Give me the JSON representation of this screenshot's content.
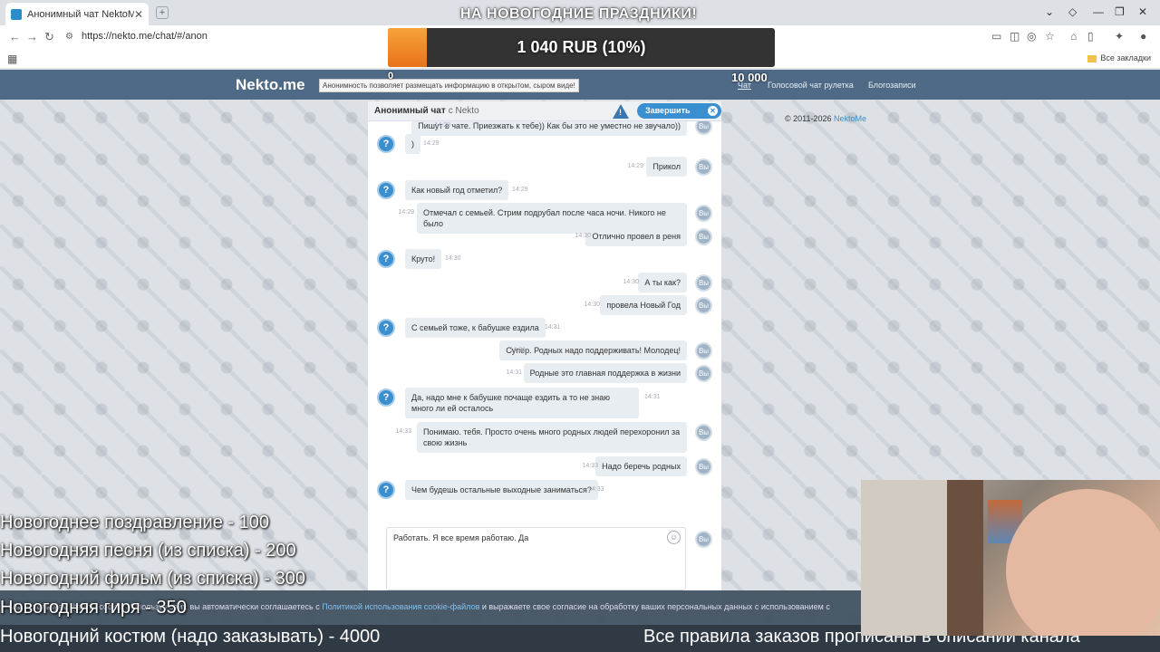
{
  "browser": {
    "tab_title": "Анонимный чат NektoMe",
    "url": "https://nekto.me/chat/#/anon",
    "bookmarks_all": "Все закладки"
  },
  "donation": {
    "title": "НА НОВОГОДНИЕ ПРАЗДНИКИ!",
    "amount": "1 040 RUB (10%)",
    "progress": 0.1,
    "min": "0",
    "max": "10 000",
    "colors": {
      "fill": "#f08a28",
      "track": "#333333"
    }
  },
  "site": {
    "logo": "Nekto.me",
    "tip": "Анонимность позволяет размещать информацию в открытом, сыром виде!",
    "nav": [
      "Чат",
      "Голосовой чат рулетка",
      "Блогозаписи"
    ],
    "copyright_prefix": "© 2011-2026",
    "copyright_brand": "NektoMe"
  },
  "chat": {
    "header_title": "Анонимный чат",
    "header_with": "с Nekto",
    "end_button": "Завершить чат",
    "me_label": "Вы",
    "partner_icon": "?",
    "messages": [
      {
        "from": "me",
        "text": "Пишут в чате. Приезжать к тебе)) Как бы это не уместно не звучало))",
        "time": "14:29"
      },
      {
        "from": "them",
        "text": ")",
        "time": "14:29"
      },
      {
        "from": "me",
        "text": "Прикол",
        "time": "14:29"
      },
      {
        "from": "them",
        "text": "Как новый год отметил?",
        "time": "14:29"
      },
      {
        "from": "me",
        "text": "Отмечал с  семьей. Стрим подрубал после часа ночи. Никого не было",
        "time": "14:29"
      },
      {
        "from": "me",
        "text": "Отлично провел в реня",
        "time": "14:30"
      },
      {
        "from": "them",
        "text": "Круто!",
        "time": "14:30"
      },
      {
        "from": "me",
        "text": "А ты как?",
        "time": "14:30"
      },
      {
        "from": "me",
        "text": "провела Новый Год",
        "time": "14:30"
      },
      {
        "from": "them",
        "text": "С семьей тоже, к бабушке ездила",
        "time": "14:31"
      },
      {
        "from": "me",
        "text": "Супер. Родных надо поддерживать! Молодец!",
        "time": "14:31"
      },
      {
        "from": "me",
        "text": "Родные это главная поддержка в жизни",
        "time": "14:31"
      },
      {
        "from": "them",
        "text": "Да, надо мне к бабушке почаще ездить а то не знаю много ли ей осталось",
        "time": "14:31"
      },
      {
        "from": "me",
        "text": "Понимаю. тебя. Просто очень много родных людей перехоронил за свою жизнь",
        "time": "14:33"
      },
      {
        "from": "me",
        "text": "Надо беречь родных",
        "time": "14:33"
      },
      {
        "from": "them",
        "text": "Чем будешь остальные выходные заниматься?",
        "time": "14:33"
      }
    ],
    "composer_value": "Работать. Я все время работаю. Да"
  },
  "overlay": {
    "price_list": [
      "Новогоднее поздравление - 100",
      "Новогодняя песня (из списка) - 200",
      "Новогодний фильм (из списка) - 300",
      "Новогодняя гиря - 350"
    ],
    "bottom_left": "Новогодний костюм (надо заказывать) - 4000",
    "bottom_right": "Все правила заказов прописаны в описании канала",
    "cookie_text": "Мы используем файлы cookie. Используя сайт, вы автоматически соглашаетесь с",
    "cookie_link": "Политикой использования cookie-файлов",
    "cookie_text2": "и выражаете свое согласие на обработку ваших персональных данных с использованием с"
  }
}
